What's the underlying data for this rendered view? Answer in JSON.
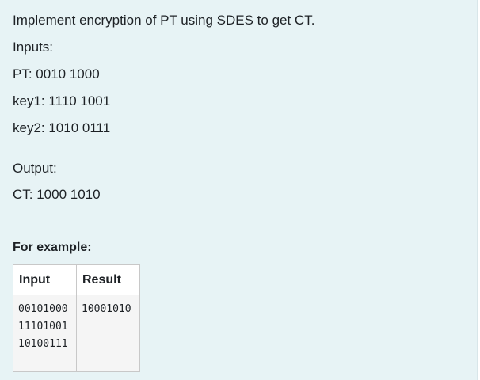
{
  "question": {
    "intro": "Implement encryption of PT using SDES to get CT.",
    "inputs_label": "Inputs:",
    "pt": "PT: 0010 1000",
    "key1": "key1: 1110 1001",
    "key2": "key2: 1010 0111",
    "output_label": "Output:",
    "ct": "CT: 1000 1010"
  },
  "examples": {
    "heading": "For example:",
    "columns": [
      "Input",
      "Result"
    ],
    "rows": [
      {
        "input_lines": [
          "00101000",
          "11101001",
          "10100111"
        ],
        "result_lines": [
          "10001010"
        ]
      }
    ]
  }
}
